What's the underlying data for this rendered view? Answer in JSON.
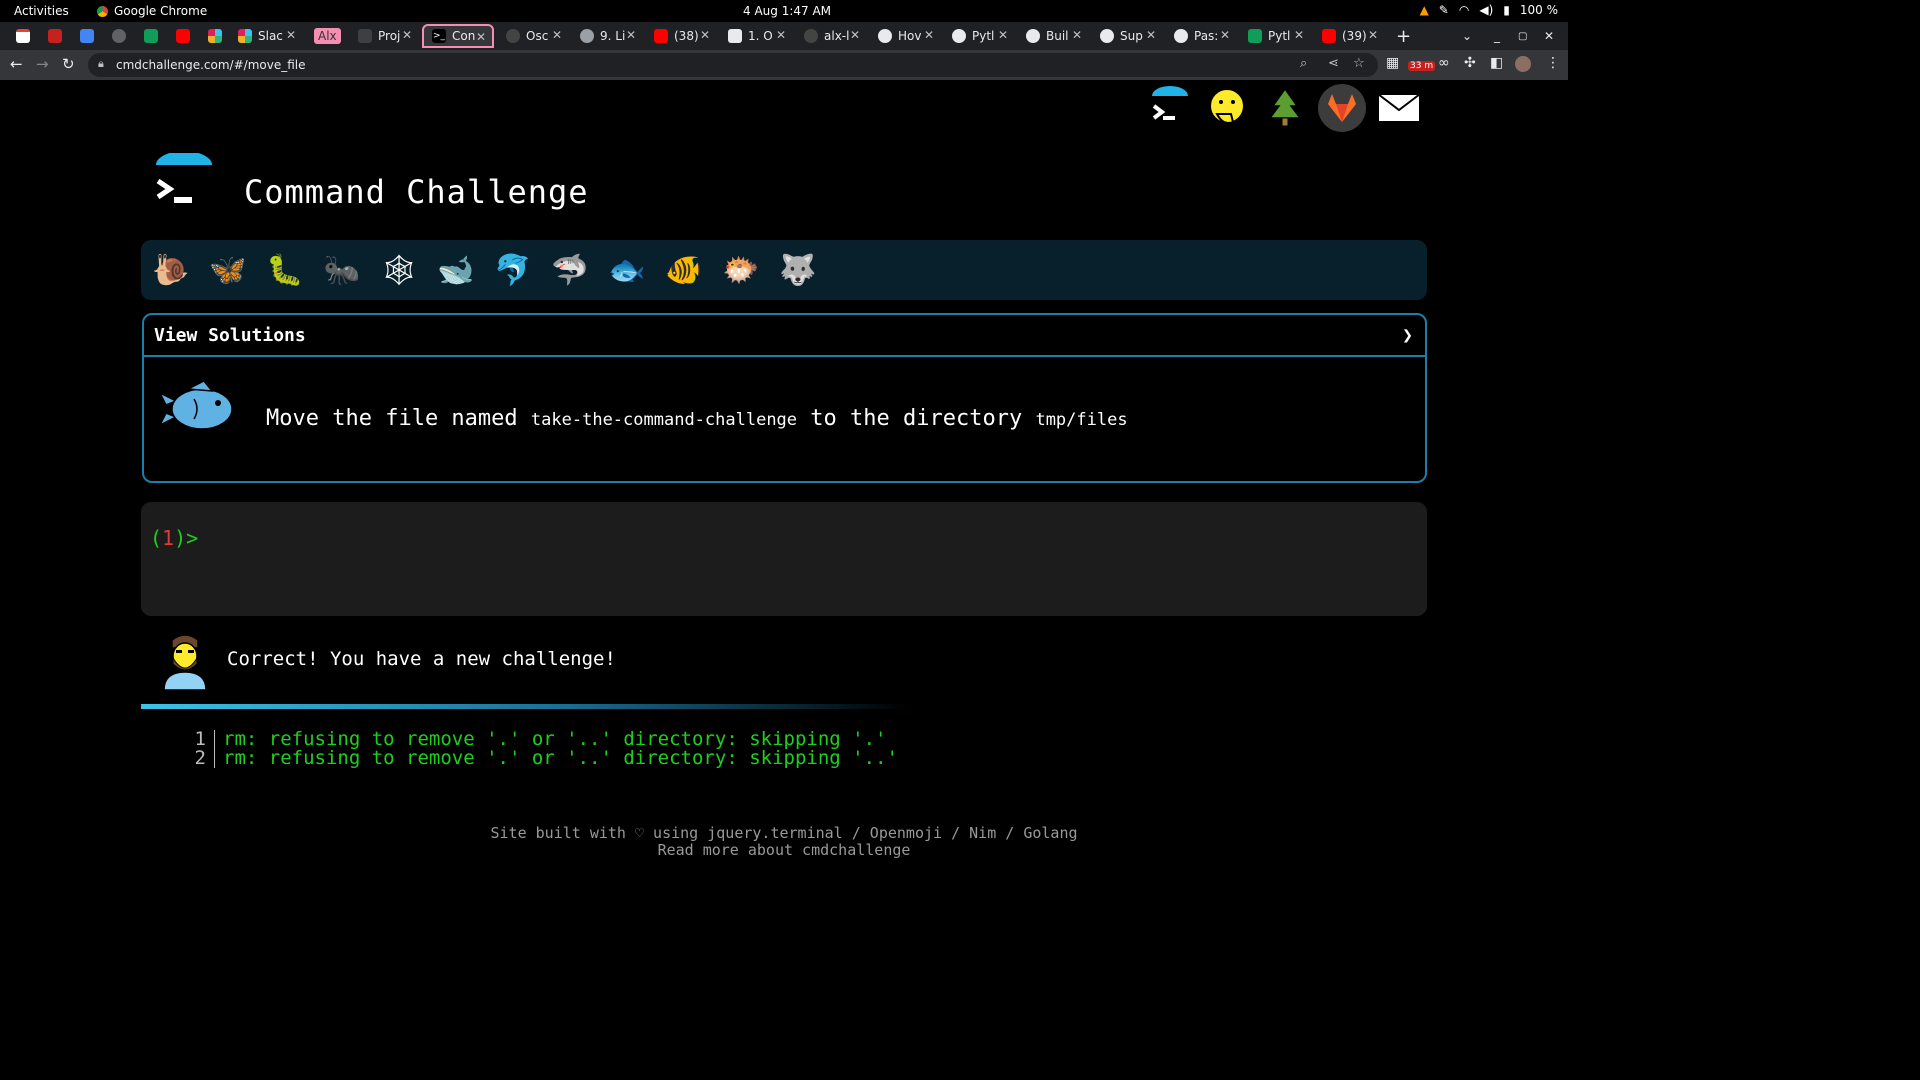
{
  "system_bar": {
    "activities": "Activities",
    "app_name": "Google Chrome",
    "clock": "4 Aug  1:47 AM",
    "battery": "100 %"
  },
  "browser": {
    "tabs": [
      {
        "label": "Slac"
      },
      {
        "label": "Alx"
      },
      {
        "label": "Proj"
      },
      {
        "label": "Con"
      },
      {
        "label": "Osc"
      },
      {
        "label": "9. Li"
      },
      {
        "label": "(38)"
      },
      {
        "label": "1. O"
      },
      {
        "label": "alx-l"
      },
      {
        "label": "Hov"
      },
      {
        "label": "Pytl"
      },
      {
        "label": "Buil"
      },
      {
        "label": "Sup"
      },
      {
        "label": "Pas:"
      },
      {
        "label": "Pytl"
      },
      {
        "label": "(39)"
      }
    ],
    "url": "cmdchallenge.com/#/move_file",
    "extension_badge": "33 m"
  },
  "site": {
    "title": "Command Challenge",
    "panel_title": "View Solutions",
    "task": {
      "prefix": "Move the file named",
      "file": "take-the-command-challenge",
      "middle": "to the directory",
      "dir": "tmp/files"
    },
    "prompt": {
      "open": "(",
      "num": "1",
      "close": ")>"
    },
    "message": "Correct! You have a new challenge!",
    "output": [
      {
        "num": "1",
        "text": "rm: refusing to remove '.' or '..' directory: skipping '.'"
      },
      {
        "num": "2",
        "text": "rm: refusing to remove '.' or '..' directory: skipping '..'"
      }
    ],
    "footer_line1": "Site built with ♡ using jquery.terminal / Openmoji / Nim / Golang",
    "footer_line2": "Read more about cmdchallenge"
  },
  "level_icons": [
    "snail-icon",
    "butterfly-icon",
    "caterpillar-icon",
    "ant-icon",
    "spider-web-icon",
    "whale-icon",
    "dolphin-icon",
    "shark-icon",
    "fish-icon",
    "tropical-fish-icon",
    "blowfish-icon",
    "wolf-icon"
  ],
  "colors": {
    "accent": "#1a7fa8",
    "prompt_green": "#1bd11b",
    "prompt_red": "#e53935",
    "active_tab_border": "#f48fb1"
  }
}
